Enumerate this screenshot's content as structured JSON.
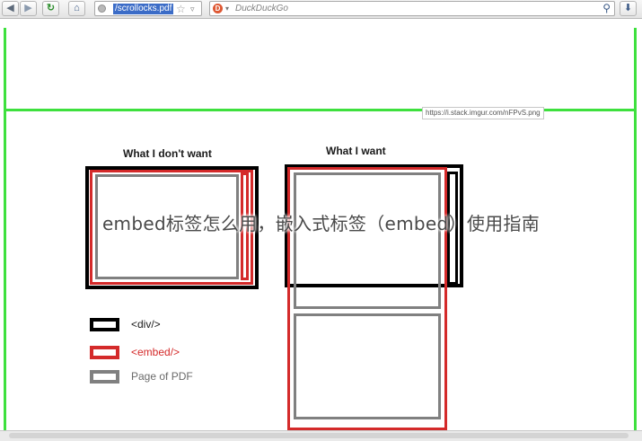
{
  "toolbar": {
    "back_icon": "back-arrow-icon",
    "forward_icon": "forward-arrow-icon",
    "reload_icon": "reload-icon",
    "home_icon": "home-icon",
    "url": "/scrollocks.pdf",
    "search_engine": "DuckDuckGo",
    "search_placeholder": "DuckDuckGo"
  },
  "page": {
    "image_credit": "https://i.stack.imgur.com/nFPvS.png",
    "heading_left": "What I don't want",
    "heading_right": "What I want",
    "legend": [
      {
        "label": "<div/>",
        "color": "#000000"
      },
      {
        "label": "<embed/>",
        "color": "#d42a2a"
      },
      {
        "label": "Page of PDF",
        "color": "#808080"
      }
    ],
    "overlay_caption": "embed标签怎么用，嵌入式标签（embed）使用指南"
  },
  "colors": {
    "green_frame": "#3ee03e",
    "div_black": "#000000",
    "embed_red": "#d42a2a",
    "pdf_gray": "#808080"
  }
}
